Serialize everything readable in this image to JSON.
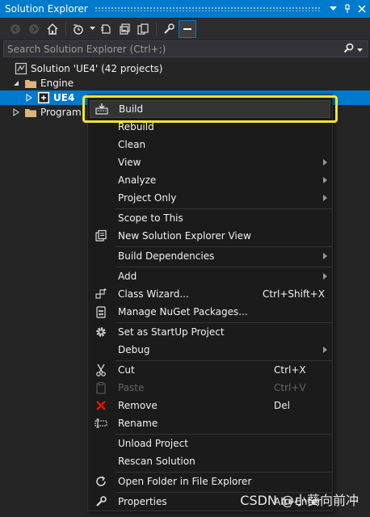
{
  "window": {
    "title": "Solution Explorer"
  },
  "search": {
    "placeholder": "Search Solution Explorer (Ctrl+;)"
  },
  "tree": {
    "solution_label": "Solution 'UE4' (42 projects)",
    "engine_label": "Engine",
    "ue4_label": "UE4",
    "programs_label": "Program"
  },
  "menu": {
    "build": "Build",
    "rebuild": "Rebuild",
    "clean": "Clean",
    "view": "View",
    "analyze": "Analyze",
    "project_only": "Project Only",
    "scope_to_this": "Scope to This",
    "new_solution_explorer_view": "New Solution Explorer View",
    "build_dependencies": "Build Dependencies",
    "add": "Add",
    "class_wizard": "Class Wizard...",
    "class_wizard_shortcut": "Ctrl+Shift+X",
    "manage_nuget": "Manage NuGet Packages...",
    "set_startup": "Set as StartUp Project",
    "debug": "Debug",
    "cut": "Cut",
    "cut_shortcut": "Ctrl+X",
    "paste": "Paste",
    "paste_shortcut": "Ctrl+V",
    "remove": "Remove",
    "remove_shortcut": "Del",
    "rename": "Rename",
    "unload_project": "Unload Project",
    "rescan_solution": "Rescan Solution",
    "open_folder": "Open Folder in File Explorer",
    "properties": "Properties",
    "properties_shortcut": "Alt+Enter"
  },
  "watermark": "CSDN @小葵向前冲",
  "colors": {
    "accent": "#007acc",
    "highlight_outline": "#f0e432",
    "remove_icon": "#e51400"
  }
}
